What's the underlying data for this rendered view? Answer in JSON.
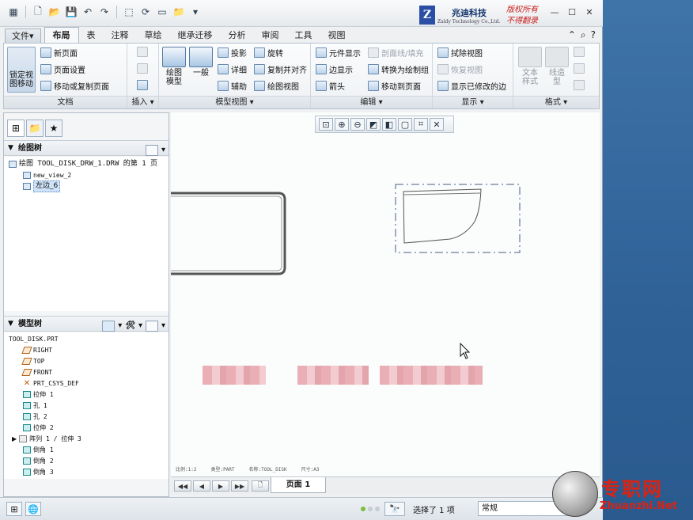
{
  "titlebar": {
    "company_logo_letter": "Z",
    "company_name": "兆迪科技",
    "company_name_en": "Zaldy Technology Co.,Ltd.",
    "slogan_line1": "版权所有",
    "slogan_line2": "不得翻录"
  },
  "tabs": [
    {
      "label": "文件",
      "suffix": "▾"
    },
    {
      "label": "布局"
    },
    {
      "label": "表"
    },
    {
      "label": "注释"
    },
    {
      "label": "草绘"
    },
    {
      "label": "继承迁移"
    },
    {
      "label": "分析"
    },
    {
      "label": "审阅"
    },
    {
      "label": "工具"
    },
    {
      "label": "视图"
    }
  ],
  "ribbon": {
    "lock_view_move": "锁定视\n图移动",
    "doc": {
      "new_page": "新页面",
      "page_setup": "页面设置",
      "move_copy_page": "移动或复制页面",
      "label": "文档"
    },
    "insert": {
      "label": "插入 ▾"
    },
    "model_views": {
      "drawing_model": "绘图\n模型",
      "general": "一般",
      "projection": "投影",
      "detailed": "详细",
      "auxiliary": "辅助",
      "revolve": "旋转",
      "copy_align": "复制并对齐",
      "drawing_view": "绘图视图",
      "label": "模型视图 ▾"
    },
    "edit": {
      "element_display": "元件显示",
      "edge_display": "边显示",
      "arrow": "箭头",
      "section_fill": "剖面线/填充",
      "convert_to_draw": "转换为绘制组",
      "move_to_page": "移动到页面",
      "label": "编辑 ▾"
    },
    "display": {
      "erase_view": "拭除视图",
      "restore_view": "恢复视图",
      "show_modified_edges": "显示已修改的边",
      "label": "显示 ▾"
    },
    "format": {
      "text_style": "文本\n样式",
      "line_style": "线造\n型",
      "label": "格式 ▾"
    }
  },
  "drawing_tree": {
    "title": "绘图树",
    "items": [
      {
        "text": "绘图 TOOL_DISK_DRW_1.DRW 的第 1 页"
      },
      {
        "text": "new_view_2"
      },
      {
        "text": "左边_6"
      }
    ]
  },
  "model_tree": {
    "title": "模型树",
    "items": [
      {
        "text": "TOOL_DISK.PRT"
      },
      {
        "text": "RIGHT"
      },
      {
        "text": "TOP"
      },
      {
        "text": "FRONT"
      },
      {
        "text": "PRT_CSYS_DEF"
      },
      {
        "text": "拉伸 1"
      },
      {
        "text": "孔 1"
      },
      {
        "text": "孔 2"
      },
      {
        "text": "拉伸 2"
      },
      {
        "text": "阵列 1 / 拉伸 3"
      },
      {
        "text": "倒角 1"
      },
      {
        "text": "倒角 2"
      },
      {
        "text": "倒角 3"
      }
    ]
  },
  "canvas": {
    "status_scale": "比例:1:2",
    "status_type": "类型:PART",
    "status_name": "名称:TOOL_DISK",
    "status_size": "尺寸:A3"
  },
  "pagebar": {
    "page_tab": "页面 1"
  },
  "statusbar": {
    "selection": "选择了 1 项",
    "filter": "常规"
  },
  "watermark": {
    "brand": "专职网",
    "url": "Zhuanzhi.Net"
  },
  "colors": {
    "accent": "#2a4fa4",
    "watermark_red": "#d21111"
  }
}
